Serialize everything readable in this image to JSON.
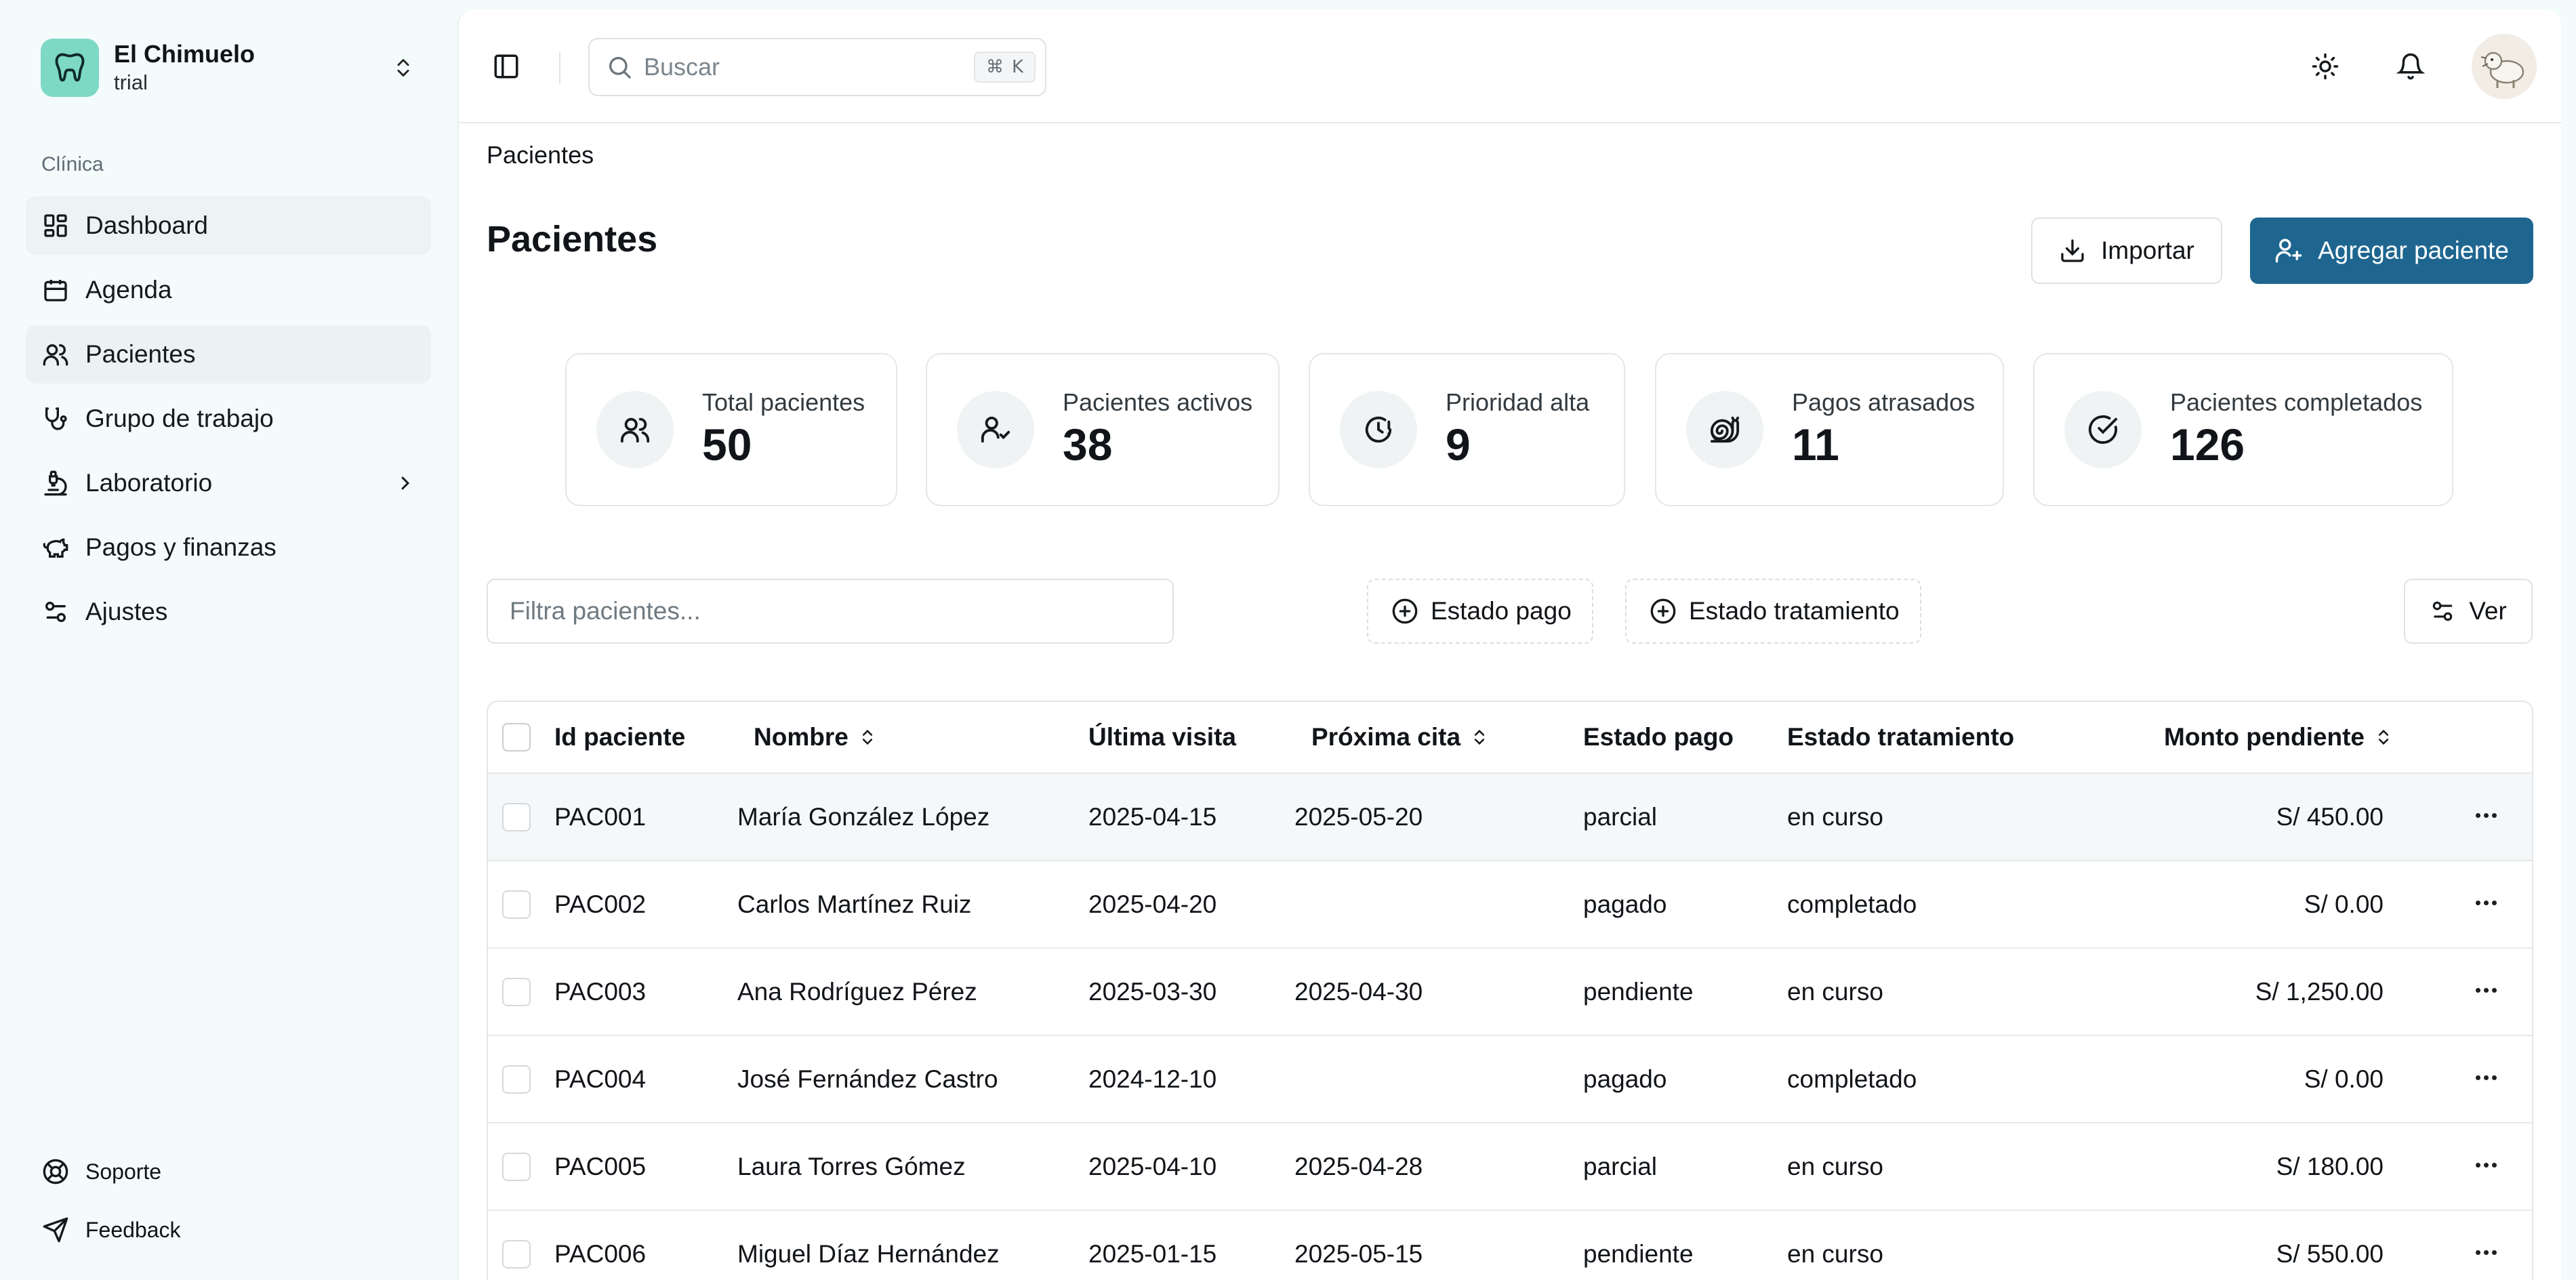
{
  "org": {
    "name": "El Chimuelo",
    "plan": "trial"
  },
  "sidebar": {
    "section": "Clínica",
    "items": [
      {
        "label": "Dashboard"
      },
      {
        "label": "Agenda"
      },
      {
        "label": "Pacientes"
      },
      {
        "label": "Grupo de trabajo"
      },
      {
        "label": "Laboratorio"
      },
      {
        "label": "Pagos y finanzas"
      },
      {
        "label": "Ajustes"
      }
    ],
    "bottom": [
      {
        "label": "Soporte"
      },
      {
        "label": "Feedback"
      }
    ]
  },
  "topbar": {
    "search_placeholder": "Buscar",
    "shortcut_mod": "⌘",
    "shortcut_key": "K"
  },
  "breadcrumb": "Pacientes",
  "page": {
    "title": "Pacientes",
    "import_label": "Importar",
    "add_label": "Agregar paciente"
  },
  "stats": [
    {
      "label": "Total pacientes",
      "value": "50",
      "icon": "users-icon"
    },
    {
      "label": "Pacientes activos",
      "value": "38",
      "icon": "user-check-icon"
    },
    {
      "label": "Prioridad alta",
      "value": "9",
      "icon": "clock-alert-icon"
    },
    {
      "label": "Pagos atrasados",
      "value": "11",
      "icon": "snail-icon"
    },
    {
      "label": "Pacientes completados",
      "value": "126",
      "icon": "circle-check-icon"
    }
  ],
  "filters": {
    "placeholder": "Filtra pacientes...",
    "payment_status": "Estado pago",
    "treatment_status": "Estado tratamiento",
    "view": "Ver"
  },
  "table": {
    "columns": {
      "id": "Id paciente",
      "name": "Nombre",
      "last_visit": "Última visita",
      "next_appt": "Próxima cita",
      "payment": "Estado pago",
      "treatment": "Estado tratamiento",
      "amount": "Monto pendiente"
    },
    "rows": [
      {
        "id": "PAC001",
        "name": "María González López",
        "last_visit": "2025-04-15",
        "next_appt": "2025-05-20",
        "payment": "parcial",
        "treatment": "en curso",
        "amount": "S/ 450.00"
      },
      {
        "id": "PAC002",
        "name": "Carlos Martínez Ruiz",
        "last_visit": "2025-04-20",
        "next_appt": "",
        "payment": "pagado",
        "treatment": "completado",
        "amount": "S/ 0.00"
      },
      {
        "id": "PAC003",
        "name": "Ana Rodríguez Pérez",
        "last_visit": "2025-03-30",
        "next_appt": "2025-04-30",
        "payment": "pendiente",
        "treatment": "en curso",
        "amount": "S/ 1,250.00"
      },
      {
        "id": "PAC004",
        "name": "José Fernández Castro",
        "last_visit": "2024-12-10",
        "next_appt": "",
        "payment": "pagado",
        "treatment": "completado",
        "amount": "S/ 0.00"
      },
      {
        "id": "PAC005",
        "name": "Laura Torres Gómez",
        "last_visit": "2025-04-10",
        "next_appt": "2025-04-28",
        "payment": "parcial",
        "treatment": "en curso",
        "amount": "S/ 180.00"
      },
      {
        "id": "PAC006",
        "name": "Miguel Díaz Hernández",
        "last_visit": "2025-01-15",
        "next_appt": "2025-05-15",
        "payment": "pendiente",
        "treatment": "en curso",
        "amount": "S/ 550.00"
      }
    ]
  },
  "colors": {
    "primary": "#1e6690",
    "logo_bg": "#7dd9c5",
    "sidebar_bg": "#f4fbfb"
  }
}
